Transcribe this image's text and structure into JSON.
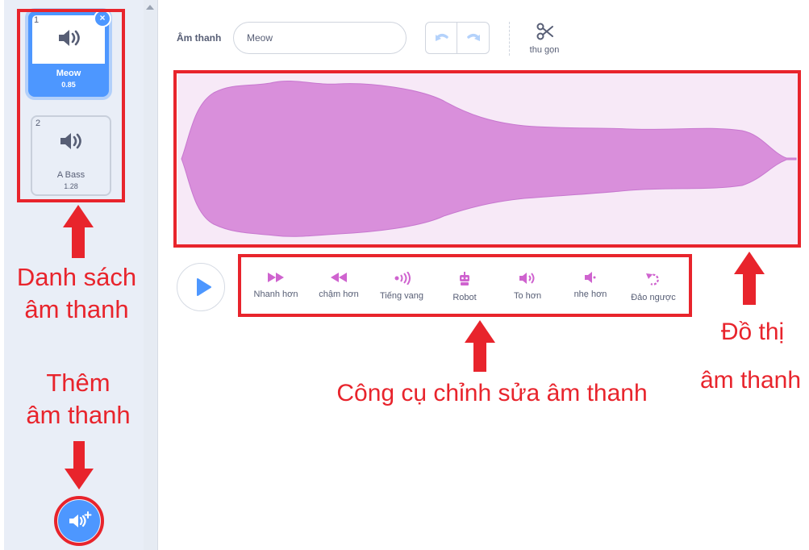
{
  "sounds": [
    {
      "index": "1",
      "name": "Meow",
      "duration": "0.85",
      "selected": true
    },
    {
      "index": "2",
      "name": "A Bass",
      "duration": "1.28",
      "selected": false
    }
  ],
  "editor": {
    "sound_label": "Âm thanh",
    "sound_name_value": "Meow",
    "trim_label": "thu gọn"
  },
  "effects": [
    {
      "label": "Nhanh hơn",
      "icon": "faster-icon"
    },
    {
      "label": "chậm hơn",
      "icon": "slower-icon"
    },
    {
      "label": "Tiếng vang",
      "icon": "echo-icon"
    },
    {
      "label": "Robot",
      "icon": "robot-icon"
    },
    {
      "label": "To hơn",
      "icon": "louder-icon"
    },
    {
      "label": "nhẹ hơn",
      "icon": "softer-icon"
    },
    {
      "label": "Đảo ngược",
      "icon": "reverse-icon"
    }
  ],
  "annotations": {
    "sound_list_1": "Danh sách",
    "sound_list_2": "âm thanh",
    "add_sound_1": "Thêm",
    "add_sound_2": "âm thanh",
    "tools": "Công cụ chỉnh sửa âm thanh",
    "graph_1": "Đồ thị",
    "graph_2": "âm thanh"
  },
  "colors": {
    "accent_blue": "#4d97ff",
    "effect_magenta": "#cf63cf",
    "waveform_fill": "#d98fdb",
    "waveform_bg": "#f7e9f7",
    "annotation_red": "#e8242c"
  }
}
